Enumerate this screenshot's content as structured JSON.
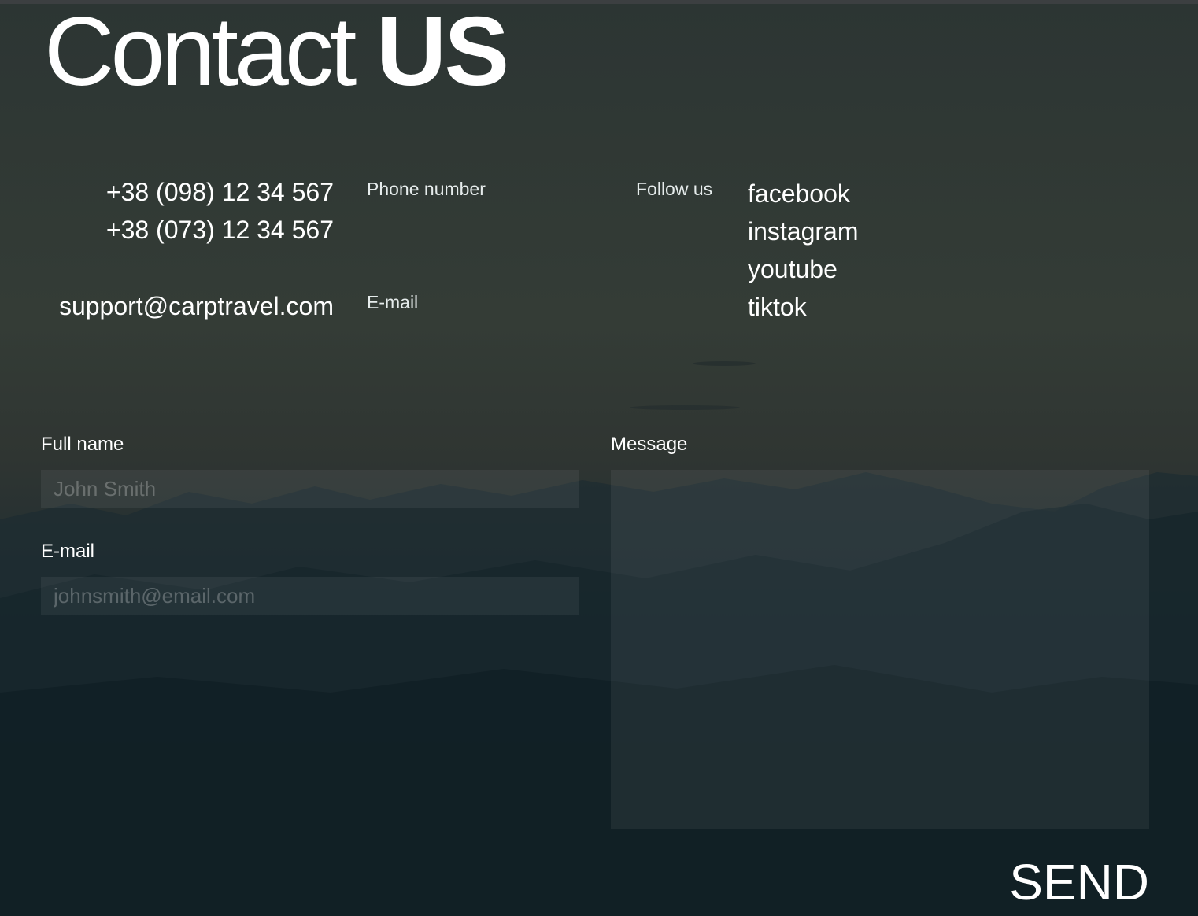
{
  "title": {
    "light": "Contact",
    "bold": "US"
  },
  "contacts": {
    "phones": [
      "+38 (098) 12 34 567",
      "+38 (073) 12 34 567"
    ],
    "phone_label": "Phone number",
    "email": "support@carptravel.com",
    "email_label": "E-mail"
  },
  "social": {
    "label": "Follow us",
    "links": [
      "facebook",
      "instagram",
      "youtube",
      "tiktok"
    ]
  },
  "form": {
    "fullname_label": "Full name",
    "fullname_placeholder": "John Smith",
    "email_label": "E-mail",
    "email_placeholder": "johnsmith@email.com",
    "message_label": "Message",
    "message_value": "",
    "send_label": "SEND"
  },
  "colors": {
    "background_top": "#2f3a38",
    "background_bottom": "#0b1a20",
    "text": "#ffffff",
    "field_fill": "rgba(255,255,255,0.06)"
  }
}
